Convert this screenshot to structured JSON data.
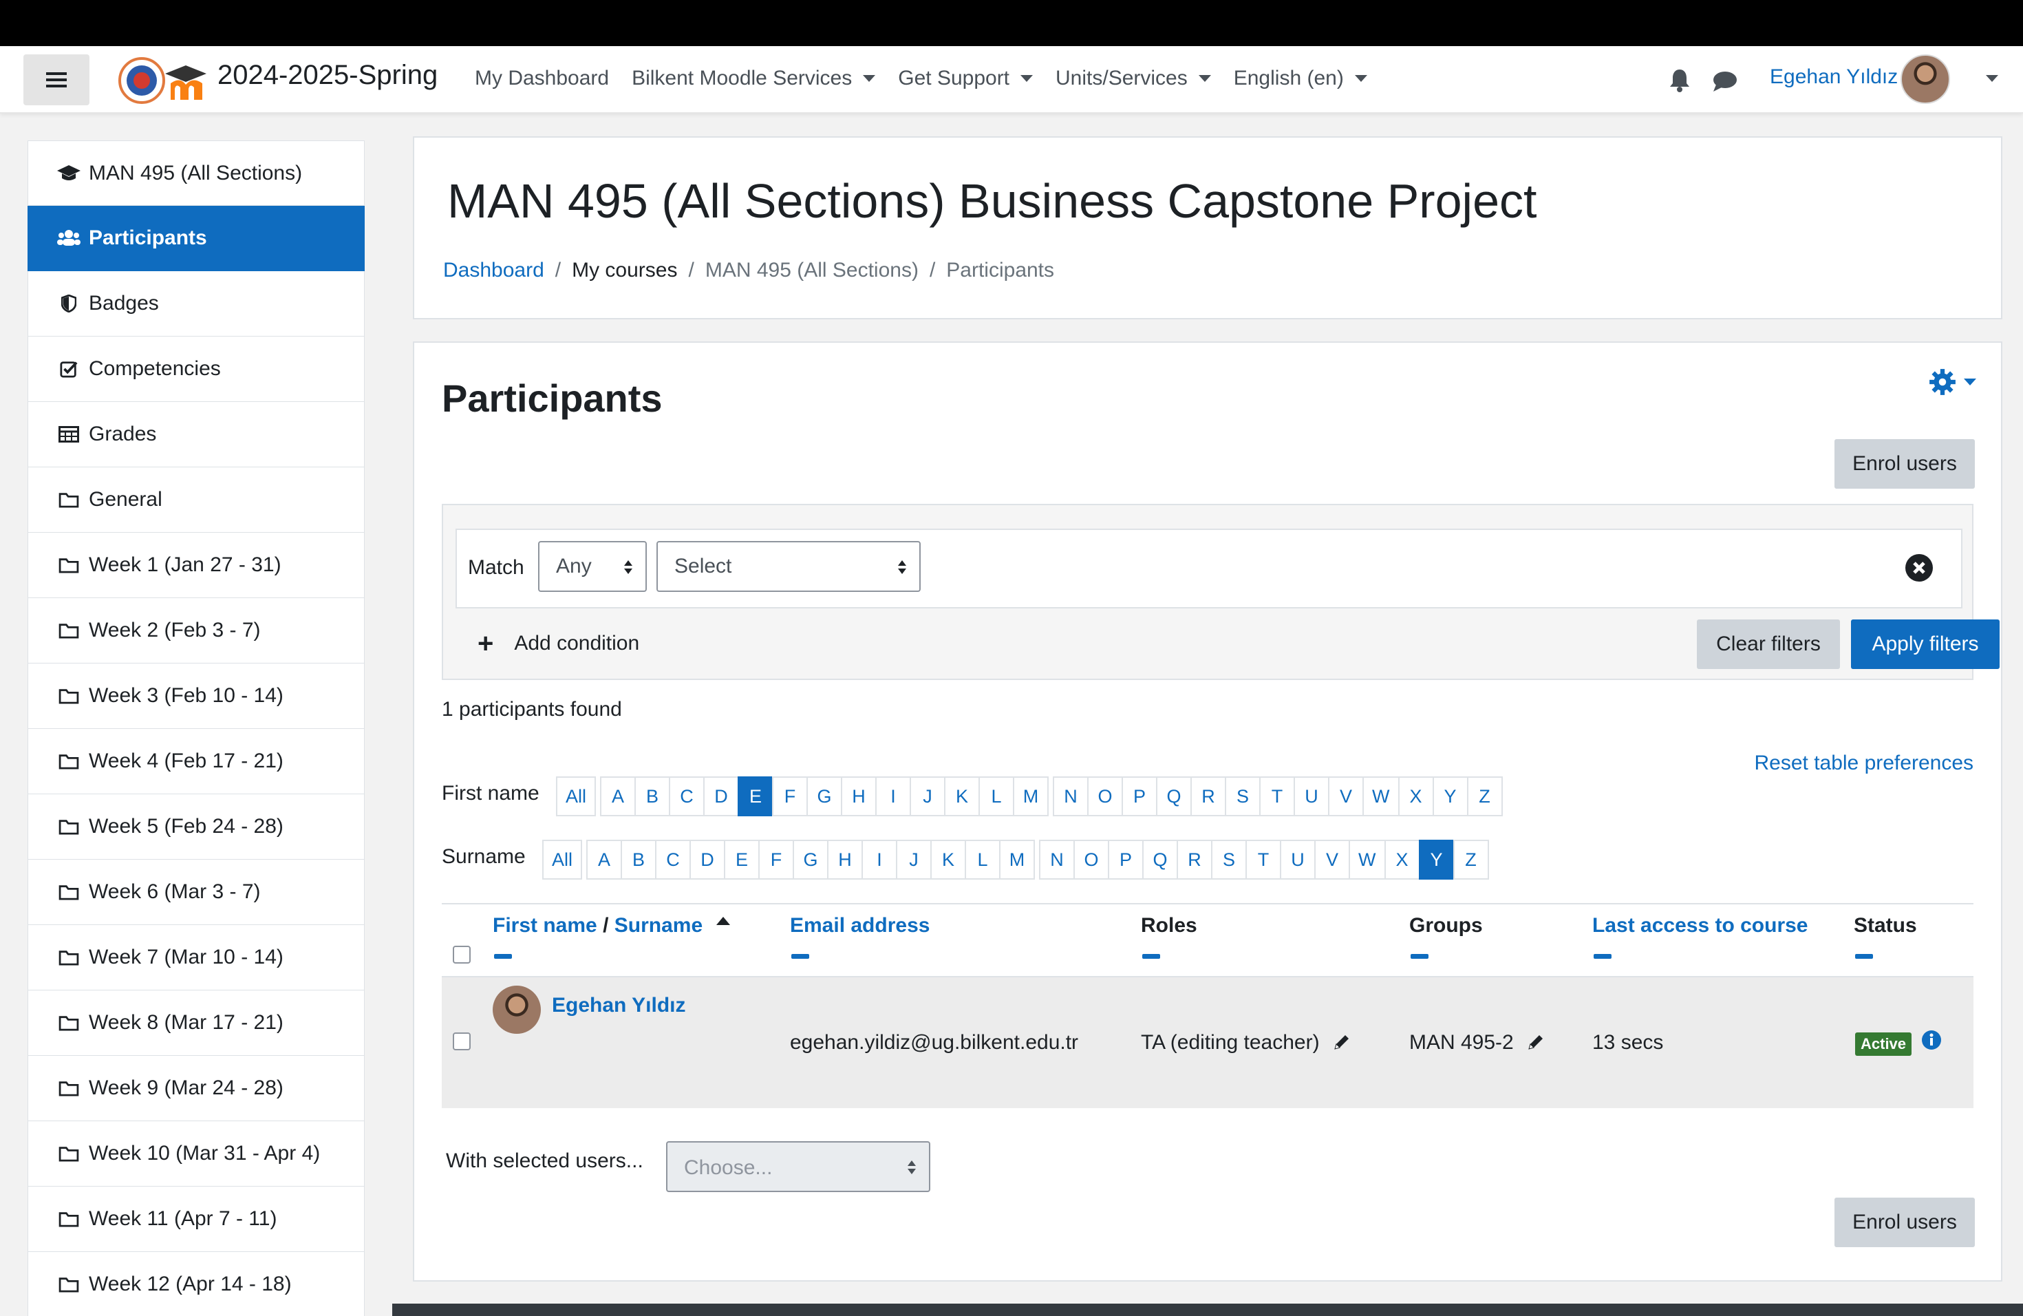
{
  "navbar": {
    "site_title": "2024-2025-Spring",
    "items": [
      {
        "label": "My Dashboard",
        "dropdown": false
      },
      {
        "label": "Bilkent Moodle Services",
        "dropdown": true
      },
      {
        "label": "Get Support",
        "dropdown": true
      },
      {
        "label": "Units/Services",
        "dropdown": true
      },
      {
        "label": "English (en)",
        "dropdown": true
      }
    ],
    "user_name": "Egehan Yıldız"
  },
  "sidebar": {
    "items": [
      {
        "label": "MAN 495 (All Sections)",
        "icon": "graduation-cap-icon",
        "active": false
      },
      {
        "label": "Participants",
        "icon": "users-icon",
        "active": true
      },
      {
        "label": "Badges",
        "icon": "shield-icon",
        "active": false
      },
      {
        "label": "Competencies",
        "icon": "check-square-icon",
        "active": false
      },
      {
        "label": "Grades",
        "icon": "table-icon",
        "active": false
      },
      {
        "label": "General",
        "icon": "folder-icon",
        "active": false
      },
      {
        "label": "Week 1 (Jan 27 - 31)",
        "icon": "folder-icon",
        "active": false
      },
      {
        "label": "Week 2 (Feb 3 - 7)",
        "icon": "folder-icon",
        "active": false
      },
      {
        "label": "Week 3 (Feb 10 - 14)",
        "icon": "folder-icon",
        "active": false
      },
      {
        "label": "Week 4 (Feb 17 - 21)",
        "icon": "folder-icon",
        "active": false
      },
      {
        "label": "Week 5 (Feb 24 - 28)",
        "icon": "folder-icon",
        "active": false
      },
      {
        "label": "Week 6 (Mar 3 - 7)",
        "icon": "folder-icon",
        "active": false
      },
      {
        "label": "Week 7 (Mar 10 - 14)",
        "icon": "folder-icon",
        "active": false
      },
      {
        "label": "Week 8 (Mar 17 - 21)",
        "icon": "folder-icon",
        "active": false
      },
      {
        "label": "Week 9 (Mar 24 - 28)",
        "icon": "folder-icon",
        "active": false
      },
      {
        "label": "Week 10 (Mar 31 - Apr 4)",
        "icon": "folder-icon",
        "active": false
      },
      {
        "label": "Week 11 (Apr 7 - 11)",
        "icon": "folder-icon",
        "active": false
      },
      {
        "label": "Week 12 (Apr 14 - 18)",
        "icon": "folder-icon",
        "active": false
      }
    ]
  },
  "header": {
    "course_title": "MAN 495 (All Sections) Business Capstone Project",
    "breadcrumb": [
      "Dashboard",
      "My courses",
      "MAN 495 (All Sections)",
      "Participants"
    ]
  },
  "participants": {
    "title": "Participants",
    "enrol_label": "Enrol users",
    "filter": {
      "match_label": "Match",
      "match_value": "Any",
      "select_value": "Select",
      "add_condition": "Add condition",
      "clear_label": "Clear filters",
      "apply_label": "Apply filters"
    },
    "found_text": "1 participants found",
    "reset_label": "Reset table preferences",
    "firstname_label": "First name",
    "surname_label": "Surname",
    "initials_all": "All",
    "letters": [
      "A",
      "B",
      "C",
      "D",
      "E",
      "F",
      "G",
      "H",
      "I",
      "J",
      "K",
      "L",
      "M",
      "N",
      "O",
      "P",
      "Q",
      "R",
      "S",
      "T",
      "U",
      "V",
      "W",
      "X",
      "Y",
      "Z"
    ],
    "firstname_selected": "E",
    "surname_selected": "Y",
    "columns": {
      "firstname": "First name",
      "slash": "/",
      "surname": "Surname",
      "email": "Email address",
      "roles": "Roles",
      "groups": "Groups",
      "last_access": "Last access to course",
      "status": "Status"
    },
    "rows": [
      {
        "name": "Egehan Yıldız",
        "email": "egehan.yildiz@ug.bilkent.edu.tr",
        "role": "TA (editing teacher)",
        "group": "MAN 495-2",
        "last_access": "13 secs",
        "status": "Active"
      }
    ],
    "bulk_label": "With selected users...",
    "bulk_placeholder": "Choose..."
  },
  "colors": {
    "primary": "#0f6cbf",
    "active_badge": "#357a32"
  }
}
